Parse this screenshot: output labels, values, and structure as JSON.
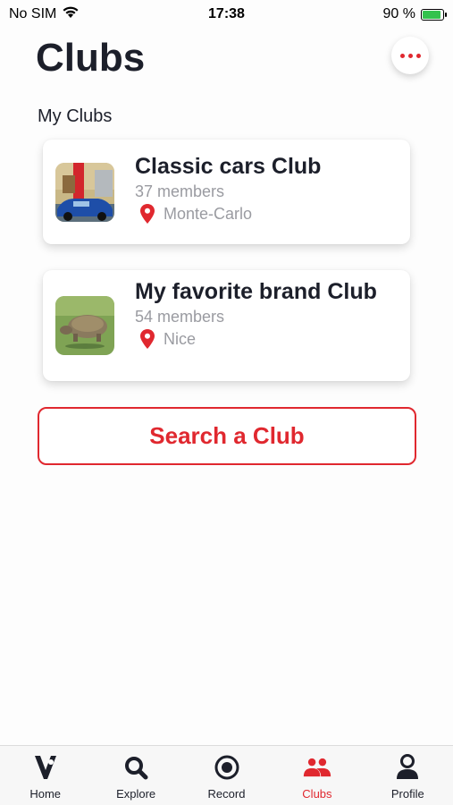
{
  "status_bar": {
    "carrier": "No SIM",
    "time": "17:38",
    "battery": "90 %",
    "battery_level": 0.9
  },
  "header": {
    "title": "Clubs",
    "more_icon": "more-dots-icon"
  },
  "section": {
    "label": "My Clubs"
  },
  "clubs": [
    {
      "name": "Classic cars Club",
      "members": "37 members",
      "location": "Monte-Carlo"
    },
    {
      "name": "My favorite brand Club",
      "members": "54 members",
      "location": "Nice"
    }
  ],
  "search_button": {
    "label": "Search a Club"
  },
  "tabs": [
    {
      "label": "Home",
      "icon": "home-logo-icon",
      "active": false
    },
    {
      "label": "Explore",
      "icon": "search-icon",
      "active": false
    },
    {
      "label": "Record",
      "icon": "record-icon",
      "active": false
    },
    {
      "label": "Clubs",
      "icon": "people-icon",
      "active": true
    },
    {
      "label": "Profile",
      "icon": "person-icon",
      "active": false
    }
  ],
  "colors": {
    "accent": "#e0282f",
    "text": "#1c1f2a",
    "muted": "#9a9ba1"
  }
}
